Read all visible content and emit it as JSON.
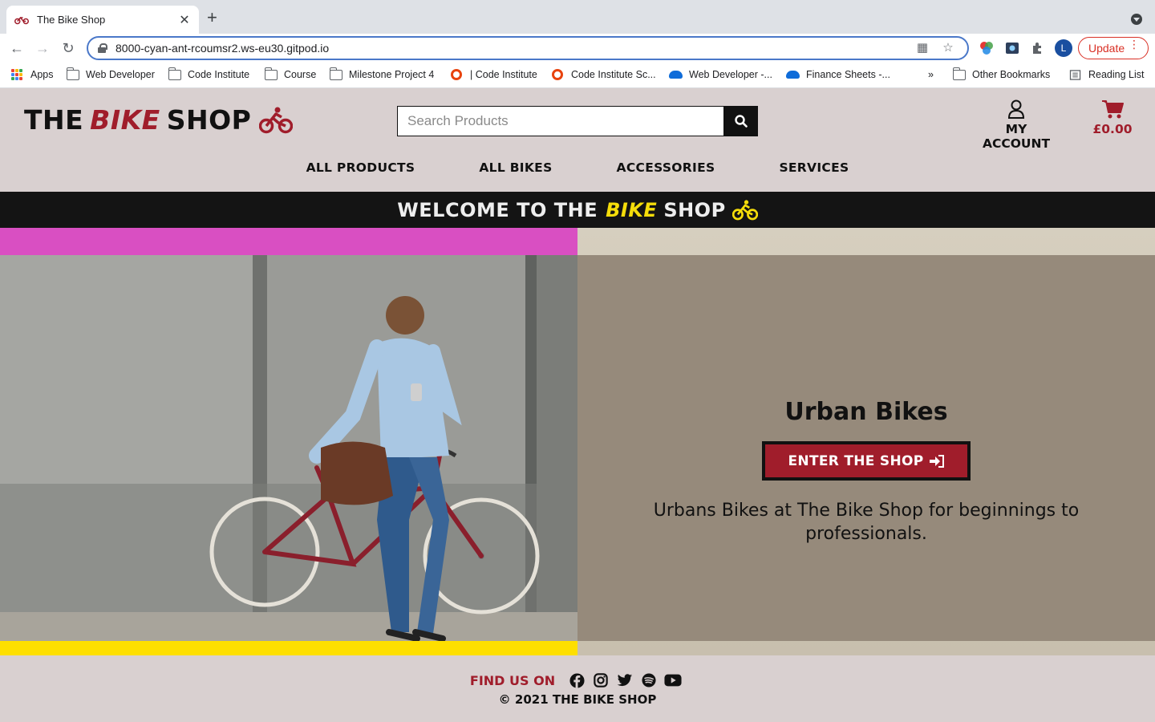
{
  "browser": {
    "tab_title": "The Bike Shop",
    "tab_close": "✕",
    "new_tab": "+",
    "url": "8000-cyan-ant-rcoumsr2.ws-eu30.gitpod.io",
    "profile_initial": "L",
    "update_label": "Update",
    "bookmarks": [
      {
        "label": "Apps",
        "icon": "apps-grid-icon"
      },
      {
        "label": "Web Developer",
        "icon": "folder-icon"
      },
      {
        "label": "Code Institute",
        "icon": "folder-icon"
      },
      {
        "label": "Course",
        "icon": "folder-icon"
      },
      {
        "label": "Milestone Project 4",
        "icon": "folder-icon"
      },
      {
        "label": "| Code Institute",
        "icon": "ring-icon"
      },
      {
        "label": "Code Institute Sc...",
        "icon": "ring-icon"
      },
      {
        "label": "Web Developer -...",
        "icon": "cloud-icon"
      },
      {
        "label": "Finance Sheets -...",
        "icon": "cloud-icon"
      }
    ],
    "bookmarks_overflow": "»",
    "other_bookmarks": "Other Bookmarks",
    "reading_list": "Reading List"
  },
  "site": {
    "logo": {
      "the": "THE",
      "bike": "BIKE",
      "shop": "SHOP"
    },
    "search_placeholder": "Search Products",
    "account_label": "MY ACCOUNT",
    "cart_total": "£0.00",
    "nav": [
      "ALL PRODUCTS",
      "ALL BIKES",
      "ACCESSORIES",
      "SERVICES"
    ],
    "welcome": {
      "prefix": "WELCOME TO THE",
      "bike": "BIKE",
      "shop": "SHOP"
    },
    "hero": {
      "title": "Urban Bikes",
      "button_label": "ENTER THE SHOP",
      "description": "Urbans Bikes at The Bike Shop for beginnings to professionals."
    },
    "footer": {
      "find_us": "FIND US ON",
      "social": [
        "facebook-icon",
        "instagram-icon",
        "twitter-icon",
        "spotify-icon",
        "youtube-icon"
      ],
      "copyright": "© 2021 THE BIKE SHOP"
    }
  },
  "colors": {
    "brand_red": "#a01d2b",
    "brand_yellow": "#f5dd0a",
    "header_bg": "#d9d0d0",
    "banner_bg": "#141414",
    "panel_bg": "#968a7b",
    "accent_pink": "#d94fc2"
  }
}
